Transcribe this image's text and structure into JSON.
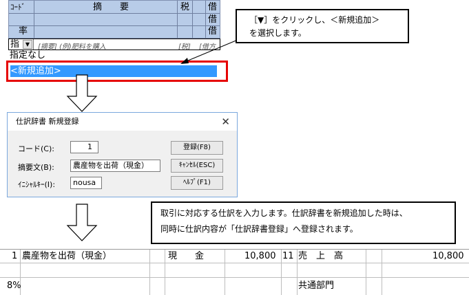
{
  "grid": {
    "col_code": "ｺｰﾄﾞ",
    "col_summary": "摘　　要",
    "col_tax": "税",
    "col_debit1": "借",
    "col_debit2": "借",
    "col_debit3": "借",
    "row_rate": "率",
    "combo_value": "指",
    "summary_placeholder": "[摘要] (例)肥料を購入",
    "tax_placeholder": "[税]",
    "debit_placeholder": "[借方",
    "list_item_none": "指定なし",
    "list_item_new": "<新規追加>"
  },
  "callout": {
    "line1": "［▼］をクリックし、＜新規追加＞",
    "line2": "を選択します。"
  },
  "dialog": {
    "title": "仕訳辞書 新規登録",
    "close": "✕",
    "code_label": "コード(C):",
    "code_value": "1",
    "summary_label": "摘要文(B):",
    "summary_value": "農産物を出荷（現金）",
    "initial_label": "ｲﾆｼｬﾙｷｰ(I):",
    "initial_value": "nousa",
    "register_button": "登録(F8)",
    "cancel_button": "ｷｬﾝｾﾙ(ESC)",
    "help_button": "ﾍﾙﾌﾟ(F1)"
  },
  "note": {
    "line1": "取引に対応する仕訳を入力します。仕訳辞書を新規追加した時は、",
    "line2": "同時に仕訳内容が「仕訳辞書登録」へ登録されます。"
  },
  "entry": {
    "code": "1",
    "summary": "農産物を出荷（現金）",
    "debit_account": "現　　金",
    "debit_amount": "10,800",
    "credit_code": "11",
    "credit_account": "売　上　高",
    "credit_amount": "10,800",
    "rate": "8%",
    "department": "共通部門"
  },
  "colors": {
    "header_bg": "#b8cce8",
    "highlight_border": "#e60000",
    "selection_bg": "#3399ff"
  }
}
